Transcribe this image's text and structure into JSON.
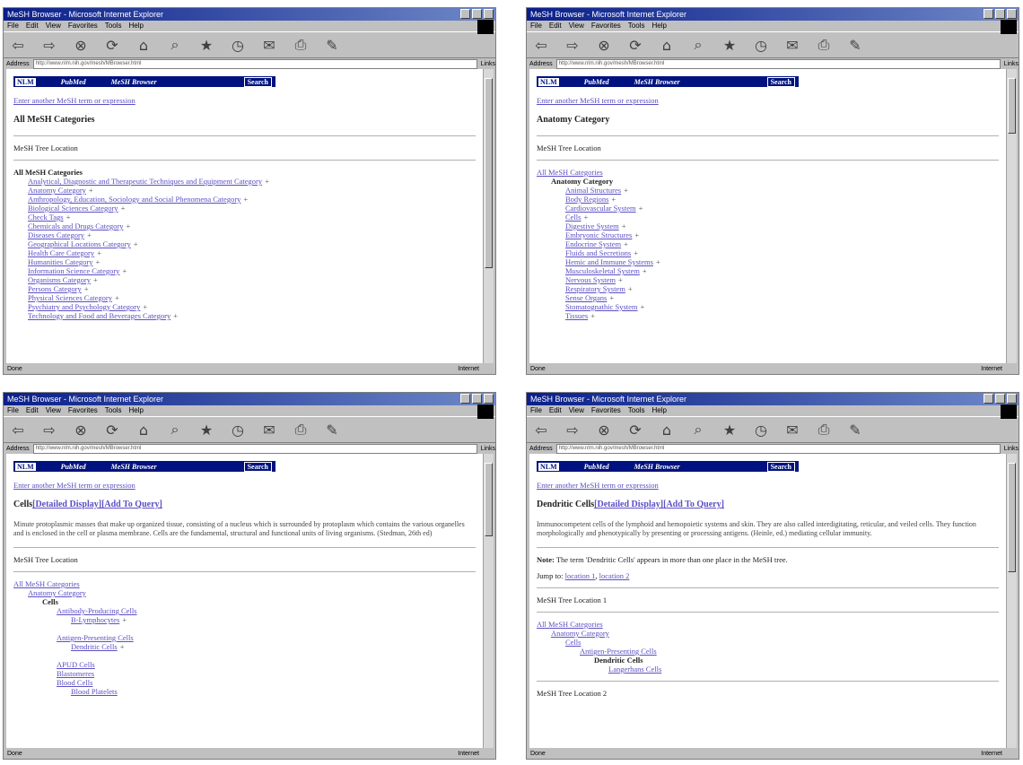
{
  "windows": [
    {
      "title": "MeSH Browser - Microsoft Internet Explorer",
      "menu": [
        "File",
        "Edit",
        "View",
        "Favorites",
        "Tools",
        "Help"
      ],
      "address_label": "Address",
      "address_url": "http://www.nlm.nih.gov/mesh/MBrowser.html",
      "go_label": "Links",
      "status": "Done",
      "zone": "Internet",
      "nav_left": "NLM",
      "nav_pubmed": "PubMed",
      "nav_browser": "MeSH Browser",
      "nav_search": "Search",
      "enter_link": "Enter another MeSH term or expression",
      "heading": "All MeSH Categories",
      "tree_label": "MeSH Tree Location",
      "tree_title": "All MeSH Categories",
      "items": [
        "Analytical, Diagnostic and Therapeutic Techniques and Equipment Category",
        "Anatomy Category",
        "Anthropology, Education, Sociology and Social Phenomena Category",
        "Biological Sciences Category",
        "Check Tags",
        "Chemicals and Drugs Category",
        "Diseases Category",
        "Geographical Locations Category",
        "Health Care Category",
        "Humanities Category",
        "Information Science Category",
        "Organisms Category",
        "Persons Category",
        "Physical Sciences Category",
        "Psychiatry and Psychology Category",
        "Technology and Food and Beverages Category"
      ]
    },
    {
      "title": "MeSH Browser - Microsoft Internet Explorer",
      "menu": [
        "File",
        "Edit",
        "View",
        "Favorites",
        "Tools",
        "Help"
      ],
      "address_label": "Address",
      "address_url": "http://www.nlm.nih.gov/mesh/MBrowser.html",
      "go_label": "Links",
      "status": "Done",
      "zone": "Internet",
      "nav_left": "NLM",
      "nav_pubmed": "PubMed",
      "nav_browser": "MeSH Browser",
      "nav_search": "Search",
      "enter_link": "Enter another MeSH term or expression",
      "heading": "Anatomy Category",
      "tree_label": "MeSH Tree Location",
      "root": "All MeSH Categories",
      "sub": "Anatomy Category",
      "items": [
        "Animal Structures",
        "Body Regions",
        "Cardiovascular System",
        "Cells",
        "Digestive System",
        "Embryonic Structures",
        "Endocrine System",
        "Fluids and Secretions",
        "Hemic and Immune Systems",
        "Musculoskeletal System",
        "Nervous System",
        "Respiratory System",
        "Sense Organs",
        "Stomatognathic System",
        "Tissues"
      ]
    },
    {
      "title": "MeSH Browser - Microsoft Internet Explorer",
      "menu": [
        "File",
        "Edit",
        "View",
        "Favorites",
        "Tools",
        "Help"
      ],
      "address_label": "Address",
      "address_url": "http://www.nlm.nih.gov/mesh/MBrowser.html",
      "go_label": "Links",
      "status": "Done",
      "zone": "Internet",
      "nav_left": "NLM",
      "nav_pubmed": "PubMed",
      "nav_browser": "MeSH Browser",
      "nav_search": "Search",
      "enter_link": "Enter another MeSH term or expression",
      "term": "Cells",
      "detail_link": "[Detailed Display]",
      "add_link": "[Add To Query]",
      "scope": "Minute protoplasmic masses that make up organized tissue, consisting of a nucleus which is surrounded by protoplasm which contains the various organelles and is enclosed in the cell or plasma membrane. Cells are the fundamental, structural and functional units of living organisms. (Stedman, 26th ed)",
      "tree_label": "MeSH Tree Location",
      "root": "All MeSH Categories",
      "sub": "Anatomy Category",
      "current": "Cells",
      "apc": "Antibody-Producing Cells",
      "b_lymph": "B-Lymphocytes",
      "antigen": "Antigen-Presenting Cells",
      "dendritic": "Dendritic Cells",
      "apud": "APUD Cells",
      "blastomeres": "Blastomeres",
      "blood": "Blood Cells",
      "platelets": "Blood Platelets"
    },
    {
      "title": "MeSH Browser - Microsoft Internet Explorer",
      "menu": [
        "File",
        "Edit",
        "View",
        "Favorites",
        "Tools",
        "Help"
      ],
      "address_label": "Address",
      "address_url": "http://www.nlm.nih.gov/mesh/MBrowser.html",
      "go_label": "Links",
      "status": "Done",
      "zone": "Internet",
      "nav_left": "NLM",
      "nav_pubmed": "PubMed",
      "nav_browser": "MeSH Browser",
      "nav_search": "Search",
      "enter_link": "Enter another MeSH term or expression",
      "term": "Dendritic Cells",
      "detail_link": "[Detailed Display]",
      "add_link": "[Add To Query]",
      "scope": "Immunocompetent cells of the lymphoid and hemopoietic systems and skin. They are also called interdigitating, reticular, and veiled cells. They function morphologically and phenotypically by presenting or processing antigens. (Heinle, ed.) mediating cellular immunity.",
      "note_label": "Note:",
      "note_text": "The term 'Dendritic Cells' appears in more than one place in the MeSH tree.",
      "jump": "Jump to:",
      "loc1": "location 1",
      "loc2": "location 2",
      "tree_label1": "MeSH Tree Location 1",
      "root": "All MeSH Categories",
      "sub": "Anatomy Category",
      "cells": "Cells",
      "antigen": "Antigen-Presenting Cells",
      "current": "Dendritic Cells",
      "langerhans": "Langerhans Cells",
      "tree_label2": "MeSH Tree Location 2"
    }
  ]
}
